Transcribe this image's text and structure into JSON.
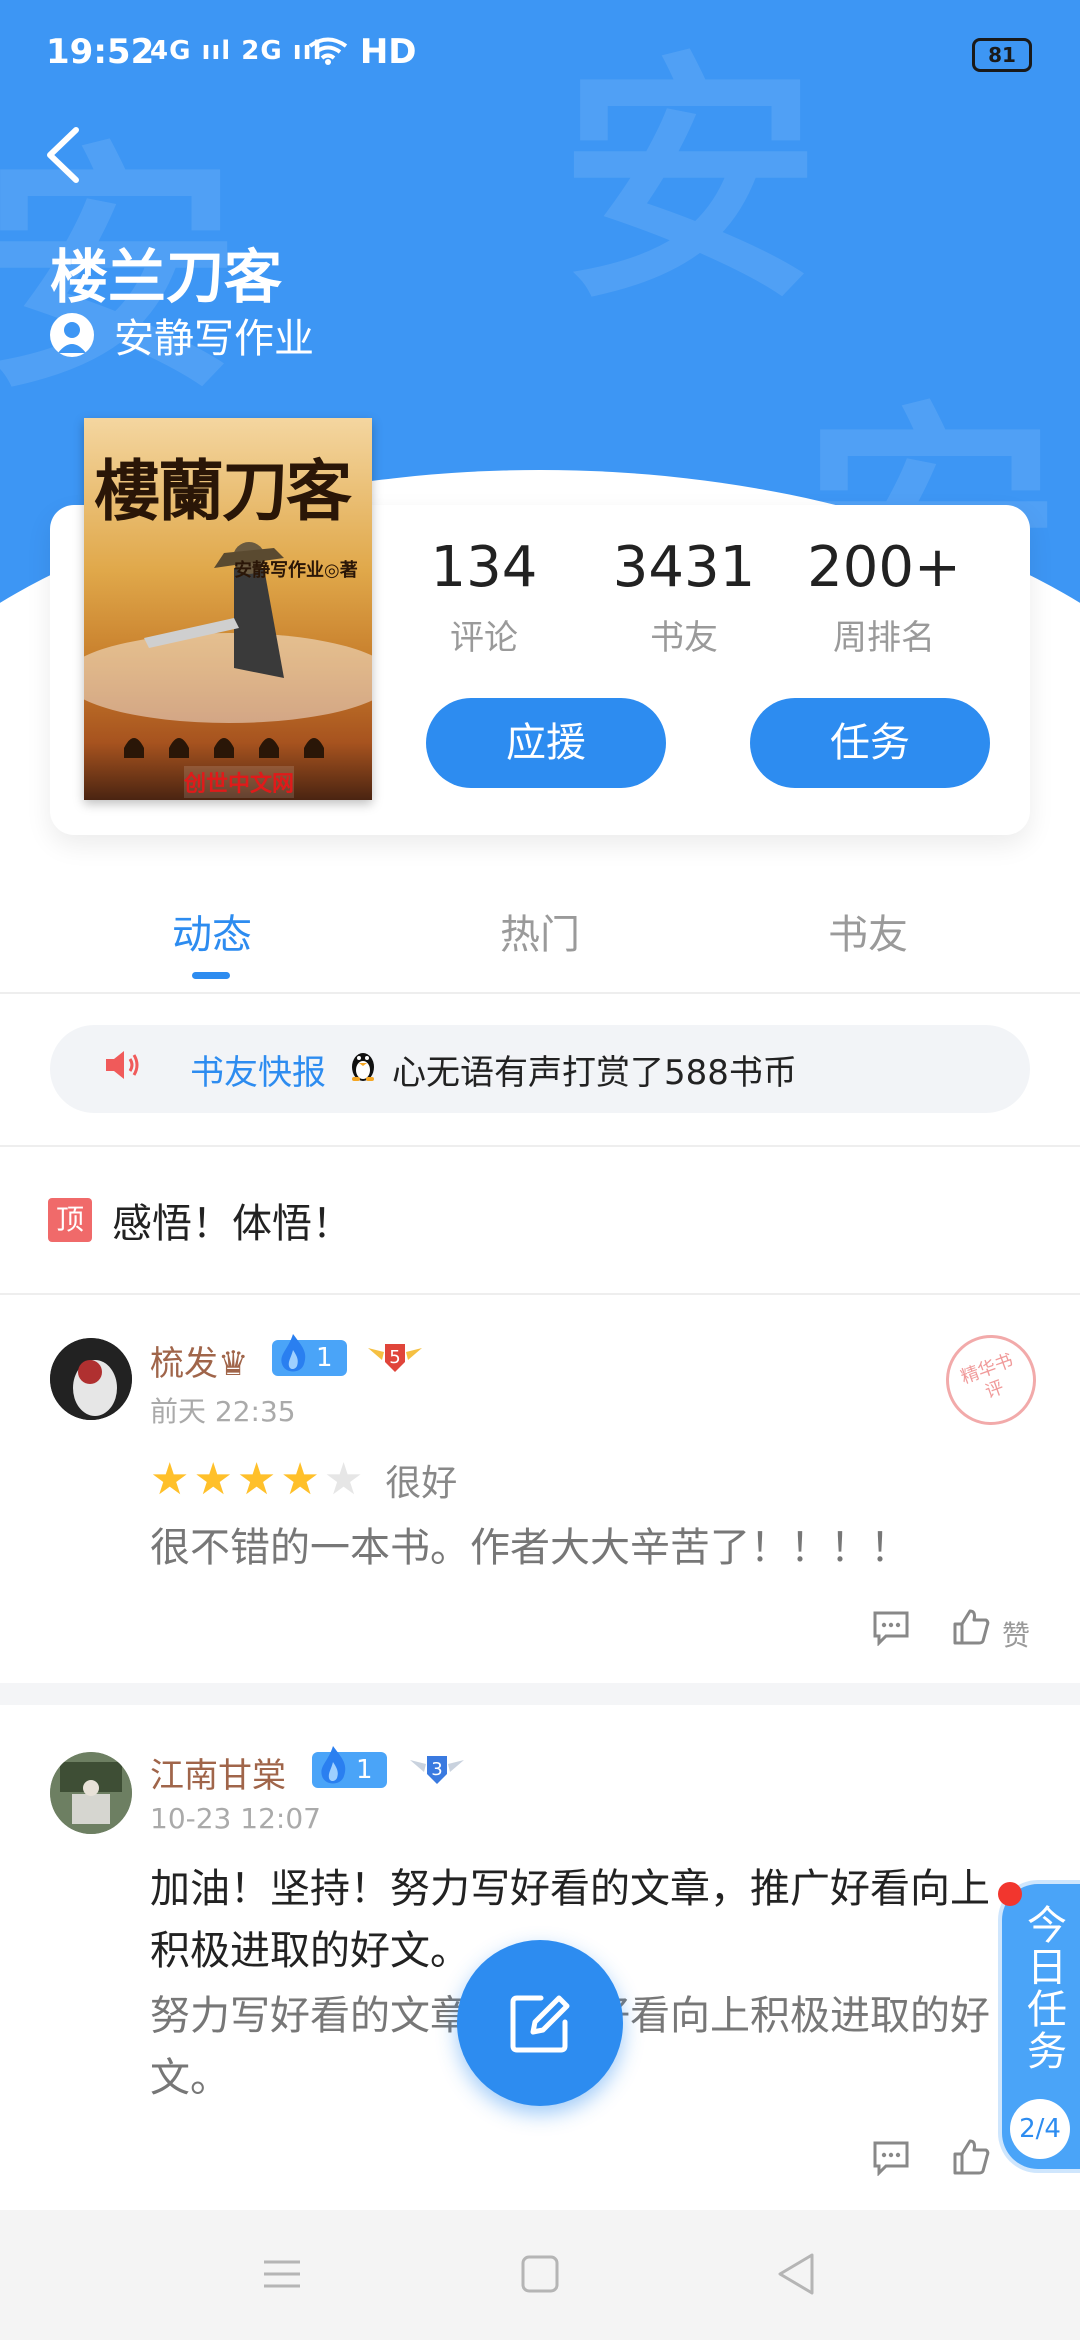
{
  "status_bar": {
    "time": "19:52",
    "signal": "4G ııl 2G ııl",
    "network": "HD",
    "battery": "81"
  },
  "header": {
    "book_title": "楼兰刀客",
    "author": "安静写作业",
    "watermark_char": "安"
  },
  "cover": {
    "title": "樓蘭刀客",
    "author_line": "安静写作业◎著",
    "publisher": "创世中文网"
  },
  "stats": [
    {
      "value": "134",
      "label": "评论"
    },
    {
      "value": "3431",
      "label": "书友"
    },
    {
      "value": "200+",
      "label": "周排名"
    }
  ],
  "buttons": {
    "support": "应援",
    "task": "任务"
  },
  "tabs": [
    {
      "label": "动态",
      "active": true
    },
    {
      "label": "热门",
      "active": false
    },
    {
      "label": "书友",
      "active": false
    }
  ],
  "news_ticker": {
    "label": "书友快报",
    "text": "心无语有声打赏了588书币"
  },
  "pinned": {
    "tag": "顶",
    "text": "感悟！体悟！"
  },
  "comments": [
    {
      "username": "梳发♛",
      "fan_level": "1",
      "rank": "5",
      "time": "前天 22:35",
      "stars": 4,
      "rating_text": "很好",
      "text": "很不错的一本书。作者大大辛苦了！！！！",
      "stamp": "精华书评",
      "like_label": "赞"
    },
    {
      "username": "江南甘棠",
      "fan_level": "1",
      "rank": "3",
      "time": "10-23 12:07",
      "text": "加油！坚持！努力写好看的文章，推广好看向上积极进取的好文。",
      "text_grey": "努力写好看的文章，推广好看向上积极进取的好文。",
      "like_label": "赞"
    }
  ],
  "task_widget": {
    "label": "今日任务",
    "progress": "2/4"
  },
  "colors": {
    "primary": "#2d8cf0",
    "hero": "#3d96f4",
    "username": "#a0654a",
    "star": "#ffc02a"
  }
}
